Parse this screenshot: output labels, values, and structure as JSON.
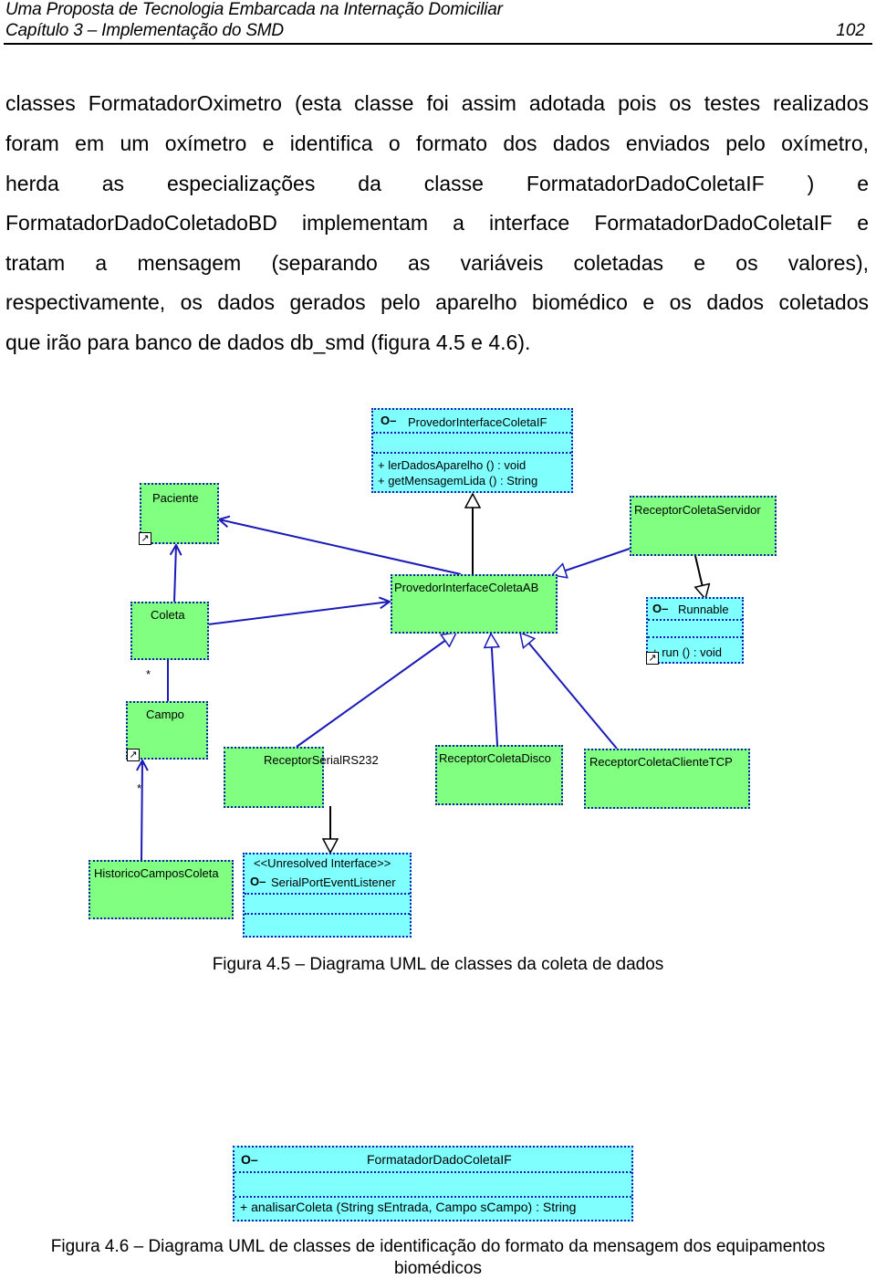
{
  "header": {
    "title": "Uma Proposta de Tecnologia Embarcada na Internação Domiciliar",
    "chapter": "Capítulo 3 – Implementação do SMD",
    "page_number": "102"
  },
  "paragraph": {
    "lines": [
      "classes FormatadorOximetro (esta classe foi assim adotada pois os testes realizados",
      "foram em um oxímetro e identifica o formato dos dados enviados pelo oxímetro,",
      "herda as especializações da classe FormatadorDadoColetaIF ) e",
      "FormatadorDadoColetadoBD implementam a interface FormatadorDadoColetaIF e",
      "tratam a mensagem (separando as variáveis coletadas e os valores),",
      "respectivamente, os dados gerados pelo aparelho biomédico e os dados coletados",
      "que irão para banco de dados db_smd (figura 4.5 e 4.6)."
    ]
  },
  "diagram1": {
    "interface_symbol": "O–",
    "shortcut_symbol": "↗",
    "provedor_if": {
      "name": "ProvedorInterfaceColetaIF",
      "ops": [
        "+  lerDadosAparelho ()    : void",
        "+  getMensagemLida ()    : String"
      ]
    },
    "paciente": "Paciente",
    "receptor_servidor": "ReceptorColetaServidor",
    "coleta": "Coleta",
    "provedor_ab": "ProvedorInterfaceColetaAB",
    "runnable": {
      "name": "Runnable",
      "ops": [
        "+  run ()  : void"
      ]
    },
    "campo": "Campo",
    "serial": "ReceptorSerialRS232",
    "disco": "ReceptorColetaDisco",
    "tcp": "ReceptorColetaClienteTCP",
    "historico": "HistoricoCamposColeta",
    "serial_listener": {
      "stereotype": "<<Unresolved Interface>>",
      "name": "SerialPortEventListener"
    },
    "multiplicity": "*",
    "caption": "Figura 4.5 – Diagrama UML de classes da coleta de dados"
  },
  "diagram2": {
    "formatador_if": {
      "name": "FormatadorDadoColetaIF",
      "ops": [
        "+  analisarColeta (String sEntrada, Campo sCampo)  : String"
      ]
    },
    "caption_line1": "Figura 4.6 – Diagrama UML de classes de identificação do formato da mensagem dos equipamentos",
    "caption_line2": "biomédicos"
  }
}
